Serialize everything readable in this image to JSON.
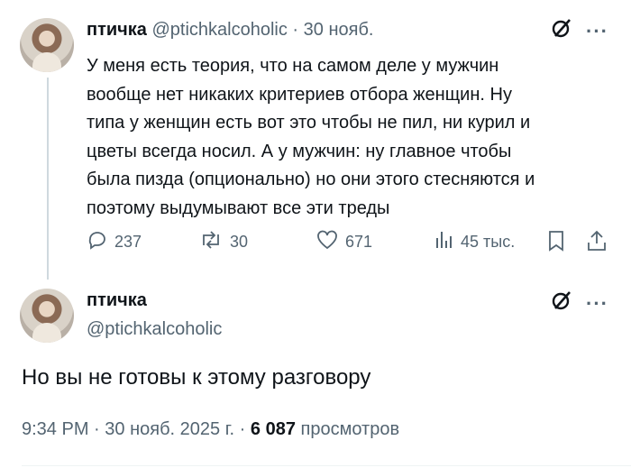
{
  "tweet1": {
    "name": "птичка",
    "handle": "@ptichkalcoholic",
    "sep": "·",
    "date": "30 нояб.",
    "text": "У меня есть теория, что на самом деле у мужчин\nвообще нет никаких критериев отбора женщин. Ну\nтипа у женщин есть вот это чтобы не пил, ни курил и\nцветы всегда носил. А у мужчин: ну главное чтобы\nбыла пизда (опционально) но они этого стесняются и\nпоэтому выдумывают все эти треды",
    "replies": "237",
    "reposts": "30",
    "likes": "671",
    "views": "45 тыс."
  },
  "tweet2": {
    "name": "птичка",
    "handle": "@ptichkalcoholic",
    "text": "Но вы не готовы к этому разговору",
    "time": "9:34 PM",
    "sep1": "·",
    "date": "30 нояб. 2025 г.",
    "sep2": "·",
    "views_count": "6 087",
    "views_label": "просмотров"
  },
  "icons": {
    "more": "more-icon",
    "grok": "grok-icon",
    "reply": "reply-icon",
    "repost": "repost-icon",
    "like": "like-icon",
    "views": "views-icon",
    "bookmark": "bookmark-icon",
    "share": "share-icon"
  }
}
